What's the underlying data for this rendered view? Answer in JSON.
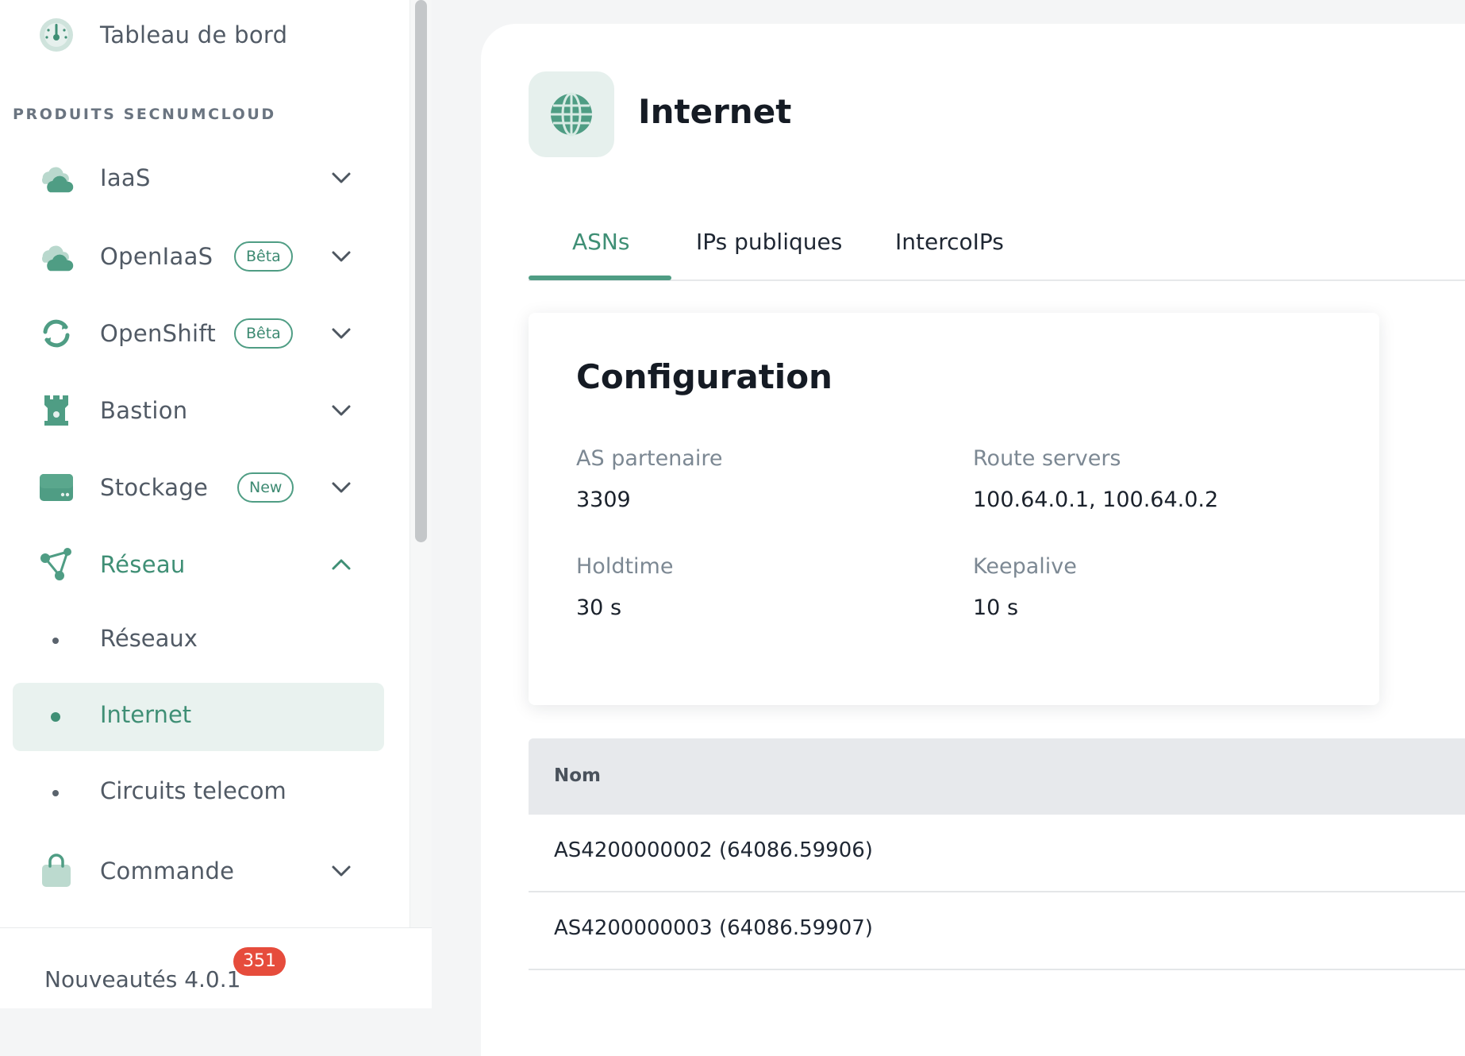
{
  "colors": {
    "accent": "#4f9d84",
    "accent_text": "#3f8f75",
    "active_bg": "#e9f2ef",
    "notification": "#e64c3c"
  },
  "sidebar": {
    "dashboard": {
      "label": "Tableau de bord",
      "icon": "gauge-icon"
    },
    "section_title": "PRODUITS SECNUMCLOUD",
    "items": [
      {
        "label": "IaaS",
        "icon": "cloud-icon",
        "badge": ""
      },
      {
        "label": "OpenIaaS",
        "icon": "cloud-icon",
        "badge": "Bêta"
      },
      {
        "label": "OpenShift",
        "icon": "refresh-icon",
        "badge": "Bêta"
      },
      {
        "label": "Bastion",
        "icon": "tower-icon",
        "badge": ""
      },
      {
        "label": "Stockage",
        "icon": "storage-icon",
        "badge": "New"
      },
      {
        "label": "Réseau",
        "icon": "network-icon",
        "badge": ""
      },
      {
        "label": "Commande",
        "icon": "bag-icon",
        "badge": ""
      }
    ],
    "network_sub": [
      {
        "label": "Réseaux"
      },
      {
        "label": "Internet"
      },
      {
        "label": "Circuits telecom"
      }
    ],
    "footer": {
      "label": "Nouveautés 4.0.1",
      "count": "351"
    }
  },
  "main": {
    "title": "Internet",
    "icon": "globe-icon",
    "tabs": [
      {
        "label": "ASNs"
      },
      {
        "label": "IPs publiques"
      },
      {
        "label": "IntercoIPs"
      }
    ],
    "config": {
      "title": "Configuration",
      "fields": [
        {
          "label": "AS partenaire",
          "value": "3309"
        },
        {
          "label": "Route servers",
          "value": "100.64.0.1, 100.64.0.2"
        },
        {
          "label": "Holdtime",
          "value": "30 s"
        },
        {
          "label": "Keepalive",
          "value": "10 s"
        }
      ]
    },
    "table": {
      "columns": [
        "Nom"
      ],
      "rows": [
        {
          "name": "AS4200000002 (64086.59906)"
        },
        {
          "name": "AS4200000003 (64086.59907)"
        }
      ]
    }
  }
}
